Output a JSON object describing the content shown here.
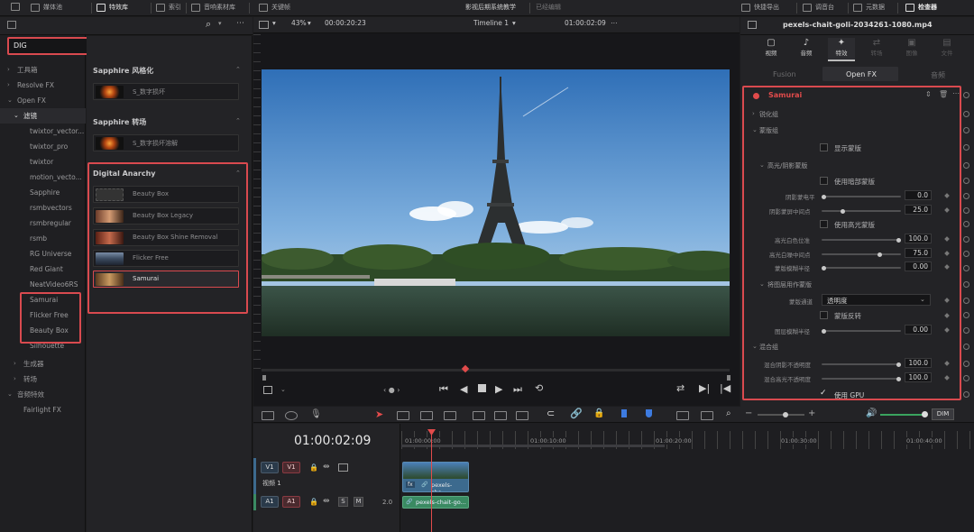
{
  "topbar": {
    "media_pool": "媒体池",
    "effects_library": "特效库",
    "index": "索引",
    "sound_library": "音响素材库",
    "keyframes": "关键帧",
    "project_title": "影视后期系统教学",
    "edited": "已经编辑",
    "quick_export": "快捷导出",
    "mixer": "调音台",
    "metadata": "元数据",
    "inspector": "检查器"
  },
  "search": {
    "value": "DIG"
  },
  "tree": {
    "toolbox": "工具箱",
    "resolve_fx": "Resolve FX",
    "open_fx": "Open FX",
    "filters": "滤镜",
    "items": [
      "twixtor_vector...",
      "twixtor_pro",
      "twixtor",
      "motion_vecto...",
      "Sapphire",
      "rsmbvectors",
      "rsmbregular",
      "rsmb",
      "RG Universe",
      "Red Giant",
      "NeatVideo6RS",
      "Samurai",
      "Flicker Free",
      "Beauty Box",
      "Silhouette"
    ],
    "generators": "生成器",
    "transitions": "转场",
    "audio_fx": "音频特效",
    "fairlight_fx": "Fairlight FX"
  },
  "fx_sections": {
    "sapphire_stylize": {
      "title": "Sapphire 风格化",
      "items": [
        "S_数字损坏"
      ]
    },
    "sapphire_transition": {
      "title": "Sapphire 转场",
      "items": [
        "S_数字损坏溶解"
      ]
    },
    "digital_anarchy": {
      "title": "Digital Anarchy",
      "items": [
        "Beauty Box",
        "Beauty Box Legacy",
        "Beauty Box Shine Removal",
        "Flicker Free",
        "Samurai"
      ]
    }
  },
  "viewer": {
    "zoom": "43%",
    "timecode_left": "00:00:20:23",
    "timeline_name": "Timeline 1",
    "timecode_right": "01:00:02:09"
  },
  "inspector": {
    "clip_name": "pexels-chait-goli-2034261-1080.mp4",
    "tabs": [
      "视频",
      "音频",
      "特效",
      "转场",
      "图像",
      "文件"
    ],
    "subtabs": [
      "Fusion",
      "Open FX",
      "音频"
    ],
    "effect_name": "Samurai",
    "groups": {
      "sharpen": "锐化组",
      "mask": "蒙版组",
      "show_mask": "显示蒙版",
      "hl_shadow": "高光/阴影蒙版",
      "use_shadow_mask": "使用暗部蒙版",
      "shadow_level": "阴影蒙电平",
      "shadow_mid": "阴影蒙屏中间点",
      "use_hl_mask": "使用高光蒙版",
      "hl_white": "高光白色位准",
      "hl_mid": "高光白噪中间点",
      "mask_blur": "蒙版模糊半径",
      "layer_mask": "将图层用作蒙版",
      "mask_channel": "蒙版通道",
      "mask_channel_val": "透明度",
      "invert_mask": "蒙版反转",
      "layer_blur": "图层模糊半径",
      "blend": "混合组",
      "blend_shadow": "混合阴影不透明度",
      "blend_hl": "混合高光不透明度",
      "use_gpu": "使用 GPU"
    },
    "values": {
      "shadow_level": "0.0",
      "shadow_mid": "25.0",
      "hl_white": "100.0",
      "hl_mid": "75.0",
      "mask_blur": "0.00",
      "layer_blur": "0.00",
      "blend_shadow": "100.0",
      "blend_hl": "100.0"
    },
    "slider_levels": {
      "shadow_level": 0.0,
      "shadow_mid": 0.25,
      "hl_white": 1.0,
      "hl_mid": 0.75,
      "mask_blur": 0.0,
      "layer_blur": 0.0,
      "blend_shadow": 1.0,
      "blend_hl": 1.0
    }
  },
  "timeline": {
    "timecode": "01:00:02:09",
    "ruler": [
      "01:00:00:00",
      "01:00:10:00",
      "01:00:20:00",
      "01:00:30:00",
      "01:00:40:00"
    ],
    "video_track": "V1",
    "video_track_name": "视频 1",
    "audio_track": "A1",
    "audio_level": "2.0",
    "video_clip": "pexels-cha...",
    "audio_clip": "pexels-chait-go...",
    "dim": "DIM",
    "solo": "S",
    "mute": "M"
  },
  "colors": {
    "highlight": "#d94a4f",
    "accent_red": "#e24b4b",
    "video_clip": "#3c6a8e",
    "audio_clip": "#3a8a62"
  }
}
